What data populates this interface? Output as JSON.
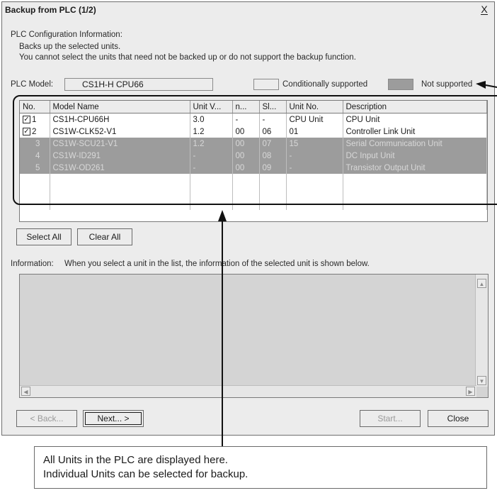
{
  "window": {
    "title": "Backup from PLC (1/2)",
    "close_glyph": "X"
  },
  "config": {
    "heading": "PLC Configuration Information:",
    "line1": "Backs up the selected units.",
    "line2": "You cannot select the units that need not be backed up or do not support the backup function."
  },
  "plc_model": {
    "label": "PLC Model:",
    "value": "CS1H-H CPU66"
  },
  "legend": {
    "conditional_label": "Conditionally supported",
    "conditional_color": "#ececec",
    "unsupported_label": "Not supported",
    "unsupported_color": "#9c9c9c"
  },
  "grid": {
    "headers": [
      "No.",
      "Model Name",
      "Unit V...",
      "n...",
      "Sl...",
      "Unit No.",
      "Description"
    ],
    "rows": [
      {
        "checked": true,
        "no": "1",
        "model": "CS1H-CPU66H",
        "unit_ver": "3.0",
        "n": "-",
        "slot": "-",
        "unit_no": "CPU Unit",
        "desc": "CPU Unit"
      },
      {
        "checked": true,
        "no": "2",
        "model": "CS1W-CLK52-V1",
        "unit_ver": "1.2",
        "n": "00",
        "slot": "06",
        "unit_no": "01",
        "desc": "Controller Link Unit"
      },
      {
        "no": "3",
        "model": "CS1W-SCU21-V1",
        "unit_ver": "1.2",
        "n": "00",
        "slot": "07",
        "unit_no": "15",
        "desc": "Serial Communication Unit"
      },
      {
        "no": "4",
        "model": "CS1W-ID291",
        "unit_ver": "-",
        "n": "00",
        "slot": "08",
        "unit_no": "-",
        "desc": "DC Input Unit"
      },
      {
        "no": "5",
        "model": "CS1W-OD261",
        "unit_ver": "-",
        "n": "00",
        "slot": "09",
        "unit_no": "-",
        "desc": "Transistor Output Unit"
      }
    ],
    "check_glyph": "✓"
  },
  "buttons": {
    "select_all": "Select All",
    "clear_all": "Clear All",
    "back": "< Back...",
    "next": "Next... >",
    "start": "Start...",
    "close": "Close"
  },
  "information": {
    "label": "Information:",
    "hint": "When you select a unit in the list, the information of the selected unit is shown below."
  },
  "callout": {
    "line1": "All Units in the PLC are displayed here.",
    "line2": "Individual Units can be selected for backup."
  }
}
